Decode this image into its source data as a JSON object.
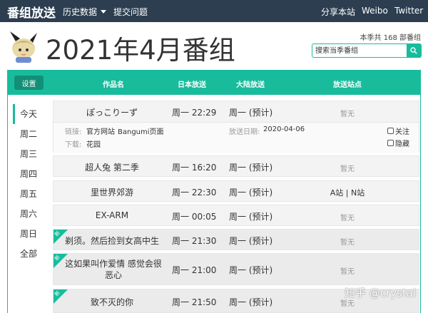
{
  "navbar": {
    "brand": "番组放送",
    "history": "历史数据",
    "report": "提交问题",
    "share": "分享本站",
    "weibo": "Weibo",
    "twitter": "Twitter"
  },
  "header": {
    "title": "2021年4月番组",
    "season_count": "本季共 168 部番组",
    "search_placeholder": "搜索当季番组"
  },
  "table": {
    "settings": "设置",
    "columns": [
      "作品名",
      "日本放送",
      "大陆放送",
      "放送站点"
    ]
  },
  "days": [
    "今天",
    "周二",
    "周三",
    "周四",
    "周五",
    "周六",
    "周日",
    "全部"
  ],
  "rows": [
    {
      "name": "ぽっこりーず",
      "jp": "周一 22:29",
      "cn": "周一 (预计)",
      "site": "暂无",
      "new": false
    },
    {
      "name": "超人兔 第二季",
      "jp": "周一 16:20",
      "cn": "周一 (预计)",
      "site": "暂无",
      "new": false
    },
    {
      "name": "里世界郊游",
      "jp": "周一 22:30",
      "cn": "周一 (预计)",
      "site": "A站 | N站",
      "new": false
    },
    {
      "name": "EX-ARM",
      "jp": "周一 00:05",
      "cn": "周一 (预计)",
      "site": "暂无",
      "new": false
    },
    {
      "name": "剃须。然后捡到女高中生",
      "jp": "周一 21:30",
      "cn": "周一 (预计)",
      "site": "暂无",
      "new": true
    },
    {
      "name": "这如果叫作爱情 感觉会很恶心",
      "jp": "周一 21:00",
      "cn": "周一 (预计)",
      "site": "暂无",
      "new": true
    },
    {
      "name": "致不灭的你",
      "jp": "周一 21:50",
      "cn": "周一 (预计)",
      "site": "暂无",
      "new": true
    }
  ],
  "ribbon_label": "新",
  "detail": {
    "link_label": "链接:",
    "link_official": "官方网站",
    "link_bangumi": "Bangumi页面",
    "download_label": "下载:",
    "download_value": "花园",
    "date_label": "放送日期:",
    "date_value": "2020-04-06",
    "follow": "关注",
    "hide": "隐藏"
  },
  "watermark": "知乎 @crystal",
  "colors": {
    "navbar": "#2c3e50",
    "accent": "#18bc9c",
    "accent_dark": "#128f76"
  }
}
